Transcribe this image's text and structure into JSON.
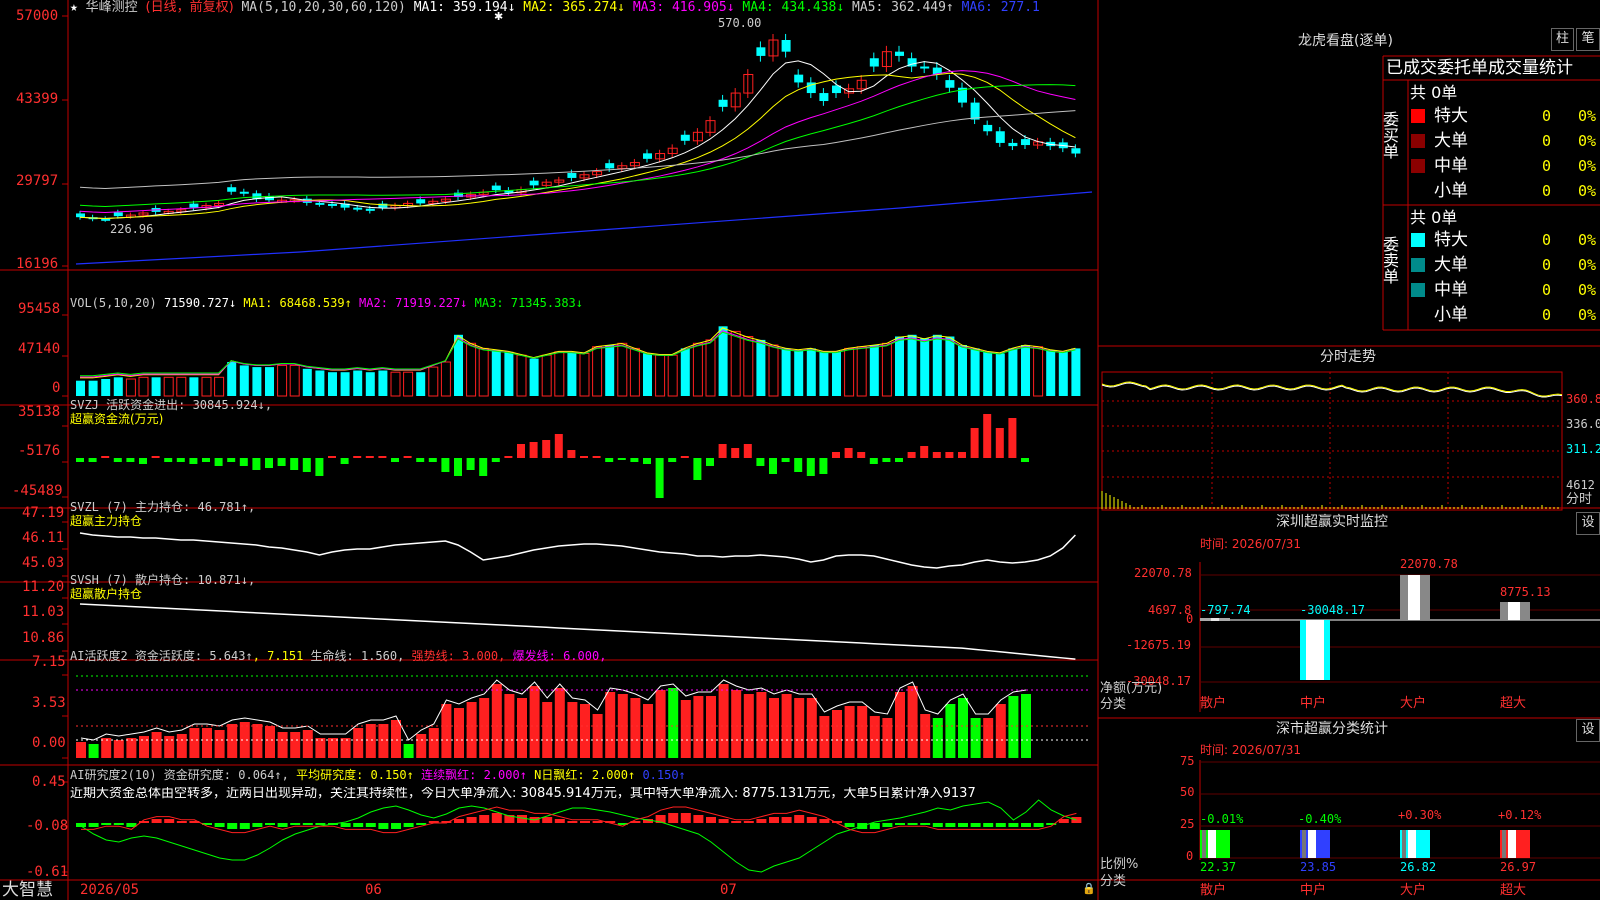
{
  "header": {
    "star_icon": "★",
    "name": "华峰测控",
    "period": "(日线，前复权)",
    "ma_label": "MA(5,10,20,30,60,120)",
    "ma1": "MA1: 359.194↓",
    "ma2": "MA2: 365.274↓",
    "ma3": "MA3: 416.905↓",
    "ma4": "MA4: 434.438↓",
    "ma5": "MA5: 362.449↑",
    "ma6": "MA6: 277.1"
  },
  "main": {
    "axis": [
      "57000",
      "43399",
      "29797",
      "16196"
    ],
    "high_label": "570.00",
    "low_label": "226.96"
  },
  "vol": {
    "title": "VOL(5,10,20)",
    "value": "71590.727↓",
    "ma1": "MA1: 68468.539↑",
    "ma2": "MA2: 71919.227↓",
    "ma3": "MA3: 71345.383↓",
    "axis": [
      "95458",
      "47140",
      "0"
    ]
  },
  "svzj": {
    "title": "SVZJ  活跃资金进出: 30845.924↓,",
    "sub": "超赢资金流(万元)",
    "axis": [
      "35138",
      "-5176",
      "-45489"
    ]
  },
  "svzl": {
    "title": "SVZL (7) 主力持仓: 46.781↑,",
    "sub": "超赢主力持仓",
    "axis": [
      "47.19",
      "46.11",
      "45.03"
    ]
  },
  "svsh": {
    "title": "SVSH (7) 散户持仓: 10.871↓,",
    "sub": "超赢散户持仓",
    "axis": [
      "11.20",
      "11.03",
      "10.86"
    ]
  },
  "ai1": {
    "title": "AI活跃度2 资金活跃度: 5.643↑",
    "v2": "7.151",
    "life": "生命线: 1.560,",
    "strong": "强势线: 3.000,",
    "burst": "爆发线: 6.000,",
    "axis": [
      "7.15",
      "3.53",
      "0.00"
    ]
  },
  "ai2": {
    "title": "AI研究度2(10) 资金研究度: 0.064↑",
    "avg": "平均研究度: 0.150↑",
    "cont": "连续飘红: 2.000↑",
    "nday": "N日飘红: 2.000↑",
    "last": "0.150↑",
    "comment": "近期大资金总体由空转多，近两日出现异动，关注其持续性，今日大单净流入: 30845.914万元，其中特大单净流入: 8775.131万元，大单5日累计净入9137",
    "axis": [
      "0.45",
      "-0.08",
      "-0.61"
    ]
  },
  "xaxis": {
    "brand": "大智慧",
    "labels": [
      "2026/05",
      "06",
      "07"
    ]
  },
  "right": {
    "lhb_title": "龙虎看盘(逐单)",
    "btn_bar": "柱",
    "btn_pen": "笔",
    "tabs_text": "已成交委托单成交量统计",
    "buy_label": "委买单",
    "sell_label": "委卖单",
    "buy_total": "共 0单",
    "sell_total": "共 0单",
    "rows": [
      {
        "name": "特大",
        "count": "0",
        "pct": "0%"
      },
      {
        "name": "大单",
        "count": "0",
        "pct": "0%"
      },
      {
        "name": "中单",
        "count": "0",
        "pct": "0%"
      },
      {
        "name": "小单",
        "count": "0",
        "pct": "0%"
      }
    ],
    "intraday_title": "分时走势",
    "intraday_axis": [
      "360.8",
      "336.0",
      "311.2",
      "4612",
      "分时"
    ],
    "monitor_title": "深圳超赢实时监控",
    "monitor_time": "时间: 2026/07/31",
    "monitor_axis": [
      "22070.78",
      "4697.8",
      "0",
      "-12675.19",
      "-30048.17"
    ],
    "monitor_values": [
      "-797.74",
      "-30048.17",
      "22070.78",
      "8775.13"
    ],
    "monitor_ylabel": "净额(万元)",
    "monitor_xlabel": "分类",
    "categories": [
      "散户",
      "中户",
      "大户",
      "超大"
    ],
    "stat_title": "深市超赢分类统计",
    "stat_time": "时间: 2026/07/31",
    "stat_axis": [
      "75",
      "50",
      "25",
      "0"
    ],
    "stat_changes": [
      "-0.01%",
      "-0.40%",
      "+0.30%",
      "+0.12%"
    ],
    "stat_values": [
      "22.37",
      "23.85",
      "26.82",
      "26.97"
    ],
    "stat_ylabel": "比例%",
    "stat_xlabel": "分类",
    "set_label": "设"
  },
  "colors": {
    "up": "#ff2020",
    "down": "#00ffff",
    "border": "#b00000",
    "yellow": "#ffff00",
    "magenta": "#ff00ff"
  }
}
